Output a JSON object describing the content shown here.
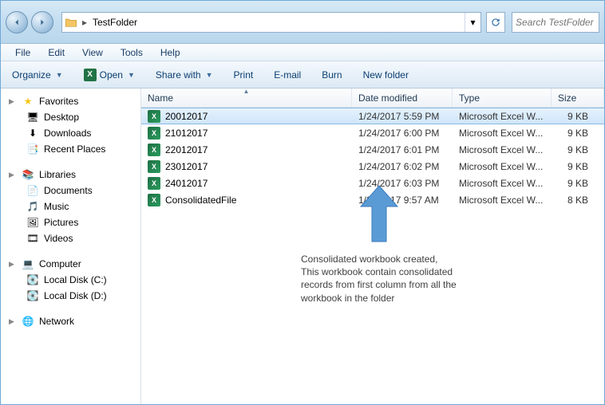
{
  "address": {
    "folder_name": "TestFolder"
  },
  "search": {
    "placeholder": "Search TestFolder"
  },
  "menu": {
    "file": "File",
    "edit": "Edit",
    "view": "View",
    "tools": "Tools",
    "help": "Help"
  },
  "toolbar": {
    "organize": "Organize",
    "open": "Open",
    "share": "Share with",
    "print": "Print",
    "email": "E-mail",
    "burn": "Burn",
    "newfolder": "New folder"
  },
  "sidebar": {
    "favorites": {
      "label": "Favorites",
      "items": [
        "Desktop",
        "Downloads",
        "Recent Places"
      ]
    },
    "libraries": {
      "label": "Libraries",
      "items": [
        "Documents",
        "Music",
        "Pictures",
        "Videos"
      ]
    },
    "computer": {
      "label": "Computer",
      "items": [
        "Local Disk (C:)",
        "Local Disk (D:)"
      ]
    },
    "network": {
      "label": "Network"
    }
  },
  "columns": {
    "name": "Name",
    "date": "Date modified",
    "type": "Type",
    "size": "Size"
  },
  "files": [
    {
      "name": "20012017",
      "date": "1/24/2017 5:59 PM",
      "type": "Microsoft Excel W...",
      "size": "9 KB",
      "selected": true
    },
    {
      "name": "21012017",
      "date": "1/24/2017 6:00 PM",
      "type": "Microsoft Excel W...",
      "size": "9 KB",
      "selected": false
    },
    {
      "name": "22012017",
      "date": "1/24/2017 6:01 PM",
      "type": "Microsoft Excel W...",
      "size": "9 KB",
      "selected": false
    },
    {
      "name": "23012017",
      "date": "1/24/2017 6:02 PM",
      "type": "Microsoft Excel W...",
      "size": "9 KB",
      "selected": false
    },
    {
      "name": "24012017",
      "date": "1/24/2017 6:03 PM",
      "type": "Microsoft Excel W...",
      "size": "9 KB",
      "selected": false
    },
    {
      "name": "ConsolidatedFile",
      "date": "1/25/2017 9:57 AM",
      "type": "Microsoft Excel W...",
      "size": "8 KB",
      "selected": false
    }
  ],
  "annotation": {
    "l1": "Consolidated workbook created,",
    "l2": "This workbook contain consolidated",
    "l3": "records from first column from all the",
    "l4": "workbook in the folder"
  }
}
